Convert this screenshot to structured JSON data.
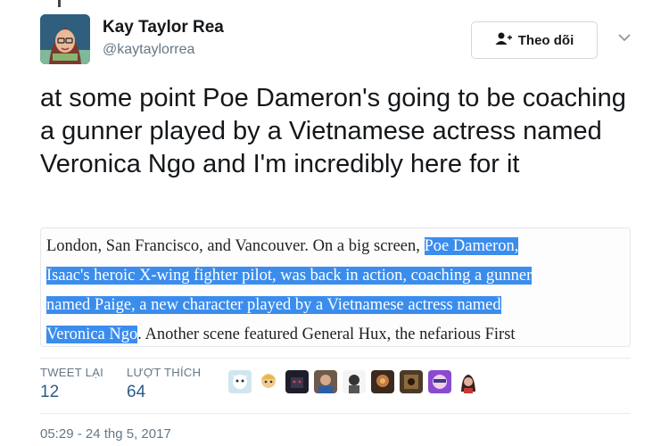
{
  "user": {
    "name": "Kay Taylor Rea",
    "handle": "@kaytaylorrea"
  },
  "follow_button": {
    "label": "Theo dõi"
  },
  "tweet": {
    "text": "at some point Poe Dameron's going to be coaching a gunner played by a Vietnamese actress named Veronica Ngo and I'm incredibly here for it"
  },
  "quote": {
    "line1_plain": "London, San Francisco, and Vancouver. On a big screen, ",
    "line1_hl": "Poe Dameron,",
    "line2_hl": "Isaac's heroic X-wing fighter pilot, was back in action, coaching a gunner",
    "line3_hl": "named Paige, a new character played by a Vietnamese actress named",
    "line4_hl": "Veronica Ngo",
    "line4_plain": ". Another scene featured General Hux, the nefarious First"
  },
  "stats": {
    "retweets_label": "TWEET LẠI",
    "retweets_value": "12",
    "likes_label": "LƯỢT THÍCH",
    "likes_value": "64"
  },
  "likers": [
    "avatar-1",
    "avatar-2",
    "avatar-3",
    "avatar-4",
    "avatar-5",
    "avatar-6",
    "avatar-7",
    "avatar-8",
    "avatar-9"
  ],
  "timestamp": "05:29 - 24 thg 5, 2017",
  "colors": {
    "highlight": "#3b8ded",
    "stat_value": "#2b5c8a",
    "muted": "#657786"
  },
  "icons": {
    "follow": "add-user-icon",
    "menu": "chevron-down-icon"
  }
}
